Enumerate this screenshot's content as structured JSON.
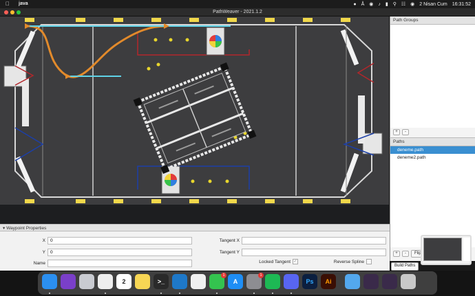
{
  "menubar": {
    "app_name": "java",
    "date": "2 Nisan Cum",
    "time": "16:31:52",
    "icons": [
      "record-icon",
      "bluetooth-icon",
      "wifi-icon",
      "speaker-icon",
      "battery-icon",
      "search-icon",
      "control-center-icon",
      "siri-icon"
    ]
  },
  "window": {
    "title": "PathWeaver - 2021.1.2"
  },
  "path_groups": {
    "header": "Path Groups",
    "add_label": "+",
    "remove_label": "-"
  },
  "paths": {
    "header": "Paths",
    "items": [
      "deneme.path",
      "deneme2.path"
    ],
    "selected_index": 0,
    "add_label": "+",
    "remove_label": "-",
    "flip_label": "Flip",
    "build_label": "Build Paths"
  },
  "waypoint_properties": {
    "header": "Waypoint Properties",
    "x_label": "X",
    "x_value": "0",
    "y_label": "Y",
    "y_value": "0",
    "name_label": "Name",
    "name_value": "",
    "tangent_x_label": "Tangent X",
    "tangent_x_value": "",
    "tangent_y_label": "Tangent Y",
    "tangent_y_value": "",
    "locked_tangent_label": "Locked Tangent",
    "locked_tangent_checked": true,
    "reverse_spline_label": "Reverse Spline",
    "reverse_spline_checked": false
  },
  "dock": {
    "apps": [
      {
        "name": "finder",
        "color": "#2b8ff0",
        "text": ""
      },
      {
        "name": "siri",
        "color": "#7a3fc9",
        "text": ""
      },
      {
        "name": "launchpad",
        "color": "#c9cbd1",
        "text": ""
      },
      {
        "name": "chrome",
        "color": "#eeeeee",
        "text": ""
      },
      {
        "name": "calendar",
        "color": "#ffffff",
        "text": "2"
      },
      {
        "name": "notes",
        "color": "#f7d654",
        "text": ""
      },
      {
        "name": "terminal",
        "color": "#2a2a2a",
        "text": ">_"
      },
      {
        "name": "vscode",
        "color": "#1e78c8",
        "text": ""
      },
      {
        "name": "photos",
        "color": "#f0f0f0",
        "text": ""
      },
      {
        "name": "facetime",
        "color": "#34c34f",
        "text": "",
        "badge": "1"
      },
      {
        "name": "app-store",
        "color": "#1e8ef5",
        "text": "A"
      },
      {
        "name": "system-preferences",
        "color": "#8d8d92",
        "text": "",
        "badge": "1"
      },
      {
        "name": "spotify",
        "color": "#1db954",
        "text": ""
      },
      {
        "name": "discord",
        "color": "#5865f2",
        "text": ""
      },
      {
        "name": "photoshop",
        "color": "#0c1f3f",
        "text": "Ps"
      },
      {
        "name": "illustrator",
        "color": "#3a0f05",
        "text": "Ai"
      },
      {
        "name": "downloads-folder",
        "color": "#53a8ee",
        "text": ""
      },
      {
        "name": "recent-window-1",
        "color": "#3a2a4a",
        "text": ""
      },
      {
        "name": "recent-window-2",
        "color": "#3a2a4a",
        "text": ""
      },
      {
        "name": "trash",
        "color": "#c8c8c8",
        "text": ""
      }
    ]
  },
  "colors": {
    "field_carpet": "#3d3d3f",
    "red_alliance": "#b3262b",
    "blue_alliance": "#1c3fa8",
    "path_orange": "#e28a2b",
    "path_cyan": "#5fd3e8",
    "selection_blue": "#3a8fd1"
  }
}
